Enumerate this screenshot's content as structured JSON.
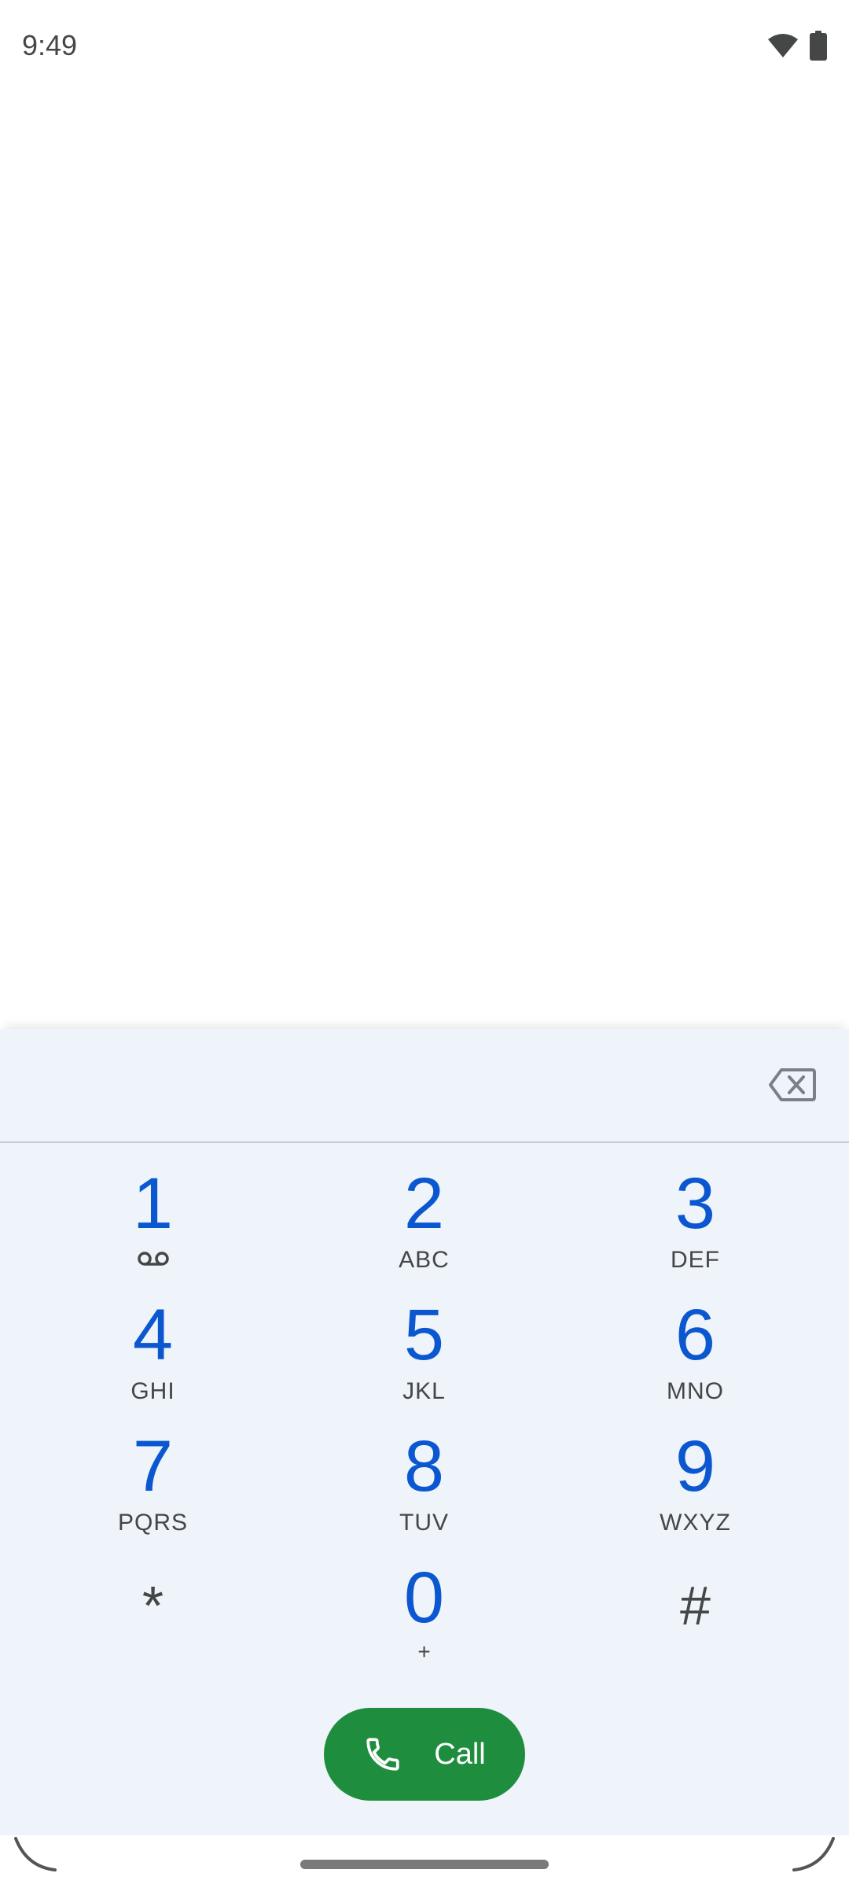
{
  "status_bar": {
    "time": "9:49",
    "icons": [
      "wifi-icon",
      "battery-icon"
    ]
  },
  "dialer": {
    "digits_value": "",
    "backspace_icon": "backspace-icon",
    "keys": [
      {
        "digit": "1",
        "sub": "",
        "sub_icon": "voicemail-icon"
      },
      {
        "digit": "2",
        "sub": "ABC"
      },
      {
        "digit": "3",
        "sub": "DEF"
      },
      {
        "digit": "4",
        "sub": "GHI"
      },
      {
        "digit": "5",
        "sub": "JKL"
      },
      {
        "digit": "6",
        "sub": "MNO"
      },
      {
        "digit": "7",
        "sub": "PQRS"
      },
      {
        "digit": "8",
        "sub": "TUV"
      },
      {
        "digit": "9",
        "sub": "WXYZ"
      },
      {
        "digit": "*",
        "sub": ""
      },
      {
        "digit": "0",
        "sub": "+"
      },
      {
        "digit": "#",
        "sub": ""
      }
    ],
    "call_label": "Call",
    "call_icon": "phone-icon"
  },
  "colors": {
    "accent": "#0b57d0",
    "call_green": "#1e8e3e",
    "sheet_bg": "#eff3fa",
    "secondary_text": "#444746"
  }
}
